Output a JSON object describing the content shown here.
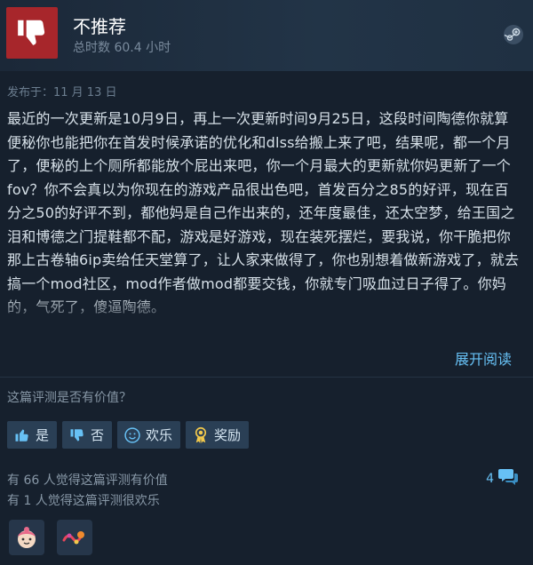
{
  "header": {
    "verdict": "不推荐",
    "hours": "总时数 60.4 小时"
  },
  "posted": "发布于：11 月 13 日",
  "review_text": "最近的一次更新是10月9日，再上一次更新时间9月25日，这段时间陶德你就算便秘你也能把你在首发时候承诺的优化和dlss给搬上来了吧，结果呢，都一个月了，便秘的上个厕所都能放个屁出来吧，你一个月最大的更新就你妈更新了一个fov？你不会真以为你现在的游戏产品很出色吧，首发百分之85的好评，现在百分之50的好评不到，都他妈是自己作出来的，还年度最佳，还太空梦，给王国之泪和博德之门提鞋都不配，游戏是好游戏，现在装死摆烂，要我说，你干脆把你那上古卷轴6ip卖给任天堂算了，让人家来做得了，你也别想着做新游戏了，就去搞一个mod社区，mod作者做mod都要交钱，你就专门吸血过日子得了。你妈的，气死了，傻逼陶德。",
  "read_more": "展开阅读",
  "helpful_question": "这篇评测是否有价值？",
  "buttons": {
    "yes": "是",
    "no": "否",
    "funny": "欢乐",
    "award": "奖励"
  },
  "stats": {
    "helpful": "有 66 人觉得这篇评测有价值",
    "funny": "有 1 人觉得这篇评测很欢乐"
  },
  "comments_count": "4",
  "icons": {
    "verdict": "thumbs-down-icon",
    "steam": "steam-logo-icon",
    "yes": "thumbs-up-icon",
    "no": "thumbs-down-icon",
    "funny": "smiley-icon",
    "award": "award-ribbon-icon",
    "comments": "speech-bubble-icon"
  },
  "colors": {
    "background": "#16202d",
    "verdict_box": "#a7262b",
    "link": "#67c1f5",
    "button": "#2a3f55"
  }
}
